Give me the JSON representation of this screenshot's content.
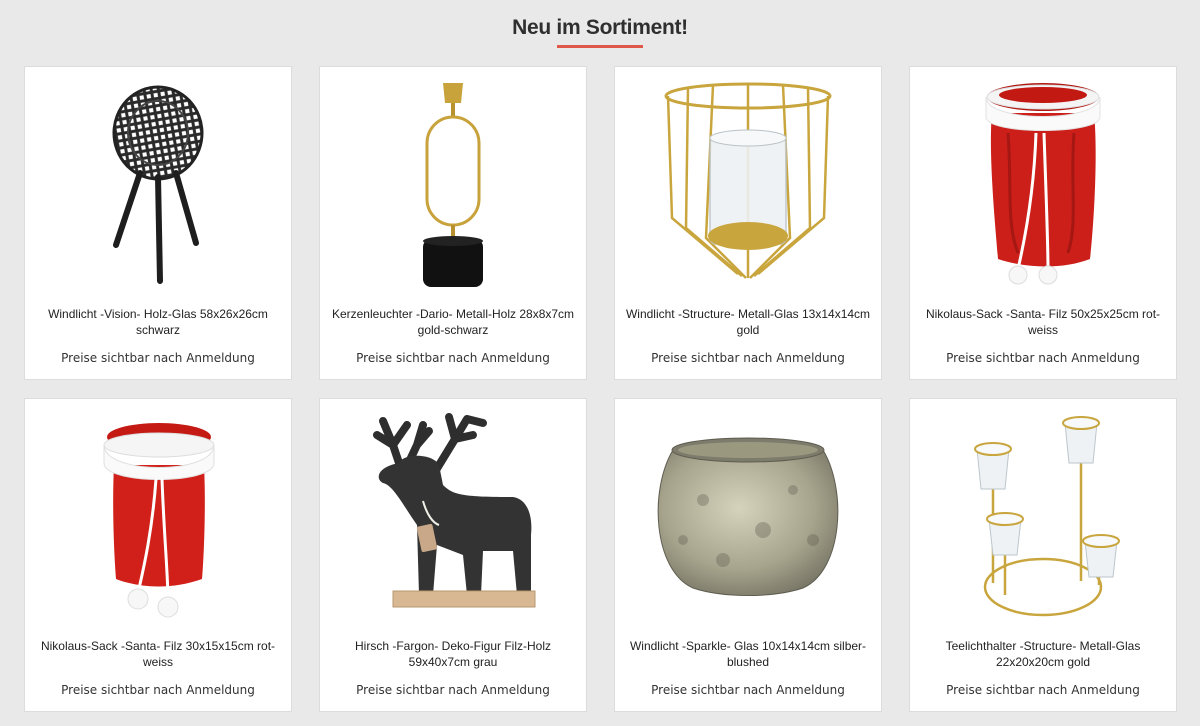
{
  "section": {
    "title": "Neu im Sortiment!"
  },
  "products": [
    {
      "name": "Windlicht -Vision- Holz-Glas 58x26x26cm schwarz",
      "price": "Preise sichtbar nach Anmeldung"
    },
    {
      "name": "Kerzenleuchter -Dario- Metall-Holz 28x8x7cm gold-schwarz",
      "price": "Preise sichtbar nach Anmeldung"
    },
    {
      "name": "Windlicht -Structure- Metall-Glas 13x14x14cm gold",
      "price": "Preise sichtbar nach Anmeldung"
    },
    {
      "name": "Nikolaus-Sack -Santa- Filz 50x25x25cm rot-weiss",
      "price": "Preise sichtbar nach Anmeldung"
    },
    {
      "name": "Nikolaus-Sack -Santa- Filz 30x15x15cm rot-weiss",
      "price": "Preise sichtbar nach Anmeldung"
    },
    {
      "name": "Hirsch -Fargon- Deko-Figur Filz-Holz 59x40x7cm grau",
      "price": "Preise sichtbar nach Anmeldung"
    },
    {
      "name": "Windlicht -Sparkle- Glas 10x14x14cm silber-blushed",
      "price": "Preise sichtbar nach Anmeldung"
    },
    {
      "name": "Teelichthalter -Structure- Metall-Glas 22x20x20cm gold",
      "price": "Preise sichtbar nach Anmeldung"
    }
  ]
}
